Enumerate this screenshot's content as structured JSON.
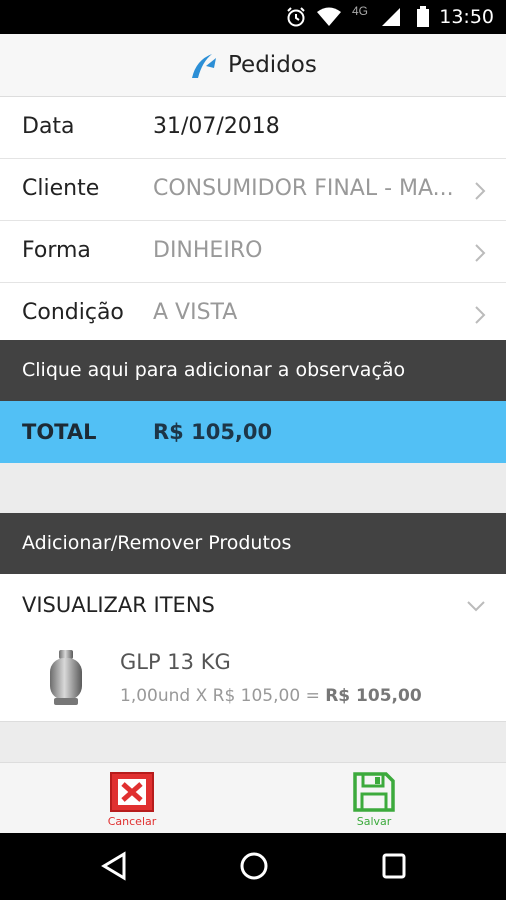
{
  "status_bar": {
    "time": "13:50",
    "network": "4G"
  },
  "header": {
    "title": "Pedidos",
    "logo_icon": "app-logo-icon"
  },
  "form": {
    "rows": [
      {
        "label": "Data",
        "value": "31/07/2018"
      },
      {
        "label": "Cliente",
        "value": "CONSUMIDOR FINAL - MA..."
      },
      {
        "label": "Forma",
        "value": "DINHEIRO"
      },
      {
        "label": "Condição",
        "value": "A VISTA"
      }
    ]
  },
  "observation": {
    "label": "Clique aqui para adicionar a observação"
  },
  "total": {
    "label": "TOTAL",
    "value": "R$ 105,00"
  },
  "products_section": {
    "label": "Adicionar/Remover Produtos"
  },
  "items": {
    "header": "VISUALIZAR ITENS",
    "list": [
      {
        "name": "GLP 13 KG",
        "qty_price": "1,00und X R$ 105,00 = ",
        "subtotal": "R$ 105,00"
      }
    ]
  },
  "actions": {
    "cancel": "Cancelar",
    "save": "Salvar"
  },
  "colors": {
    "total_bg": "#52c0f5",
    "dark_bar": "#424242",
    "cancel": "#e03030",
    "save": "#3caa3c"
  }
}
